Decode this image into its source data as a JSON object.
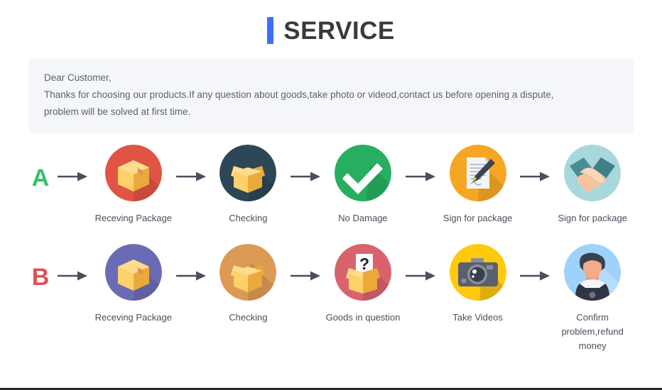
{
  "header": {
    "accent_color": "#3d6eff",
    "title": "SERVICE"
  },
  "notice": {
    "line1": "Dear Customer,",
    "line2": "Thanks for choosing our products.If any question about goods,take photo or videod,contact us before opening a dispute,",
    "line3": "problem will be solved at first time."
  },
  "flows": [
    {
      "badge": "A",
      "badge_color": "#34c36b",
      "steps": [
        {
          "icon": "closed-box-icon",
          "circle_color": "#e05443",
          "label": "Receving Package"
        },
        {
          "icon": "open-box-icon",
          "circle_color": "#2e4756",
          "label": "Checking"
        },
        {
          "icon": "check-mark-icon",
          "circle_color": "#27ae60",
          "label": "No Damage"
        },
        {
          "icon": "document-pen-icon",
          "circle_color": "#f5a623",
          "label": "Sign for package"
        },
        {
          "icon": "handshake-icon",
          "circle_color": "#a8d8dc",
          "label": "Sign for package"
        }
      ]
    },
    {
      "badge": "B",
      "badge_color": "#e05057",
      "steps": [
        {
          "icon": "closed-box-icon",
          "circle_color": "#6b6bb5",
          "label": "Receving Package"
        },
        {
          "icon": "open-box-icon",
          "circle_color": "#dd9a55",
          "label": "Checking"
        },
        {
          "icon": "question-box-icon",
          "circle_color": "#d8636d",
          "label": "Goods in question"
        },
        {
          "icon": "camera-icon",
          "circle_color": "#ffc90e",
          "label": "Take Videos"
        },
        {
          "icon": "person-avatar-icon",
          "circle_color": "#9fd2fb",
          "label": "Confirm problem,refund money"
        }
      ]
    }
  ]
}
